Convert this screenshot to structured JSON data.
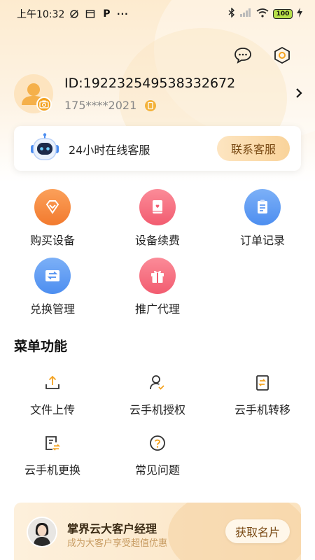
{
  "status_bar": {
    "time": "上午10:32",
    "battery": "100"
  },
  "header": {
    "message_icon": "chat-bubble-icon",
    "settings_icon": "hex-gear-icon"
  },
  "profile": {
    "id_text": "ID:1922325495383326​72",
    "phone": "175****2021"
  },
  "service": {
    "text": "24小时在线客服",
    "button": "联系客服"
  },
  "actions": [
    {
      "label": "购买设备",
      "color": "#f58a3c",
      "icon": "diamond-icon"
    },
    {
      "label": "设备续费",
      "color": "#f56a7a",
      "icon": "book-icon"
    },
    {
      "label": "订单记录",
      "color": "#4d8ef0",
      "icon": "clipboard-icon"
    },
    {
      "label": "兑换管理",
      "color": "#4d8ef0",
      "icon": "exchange-icon"
    },
    {
      "label": "推广代理",
      "color": "#f56a7a",
      "icon": "gift-icon"
    }
  ],
  "menu": {
    "title": "菜单功能",
    "items": [
      {
        "label": "文件上传",
        "icon": "upload-icon"
      },
      {
        "label": "云手机授权",
        "icon": "user-check-icon"
      },
      {
        "label": "云手机转移",
        "icon": "transfer-icon"
      },
      {
        "label": "云手机更换",
        "icon": "replace-icon"
      },
      {
        "label": "常见问题",
        "icon": "question-icon"
      }
    ]
  },
  "manager": {
    "title": "掌界云大客户经理",
    "subtitle": "成为大客户享受超值优惠",
    "button": "获取名片"
  },
  "colors": {
    "accent": "#f4a21f",
    "brown": "#7a4a14"
  }
}
